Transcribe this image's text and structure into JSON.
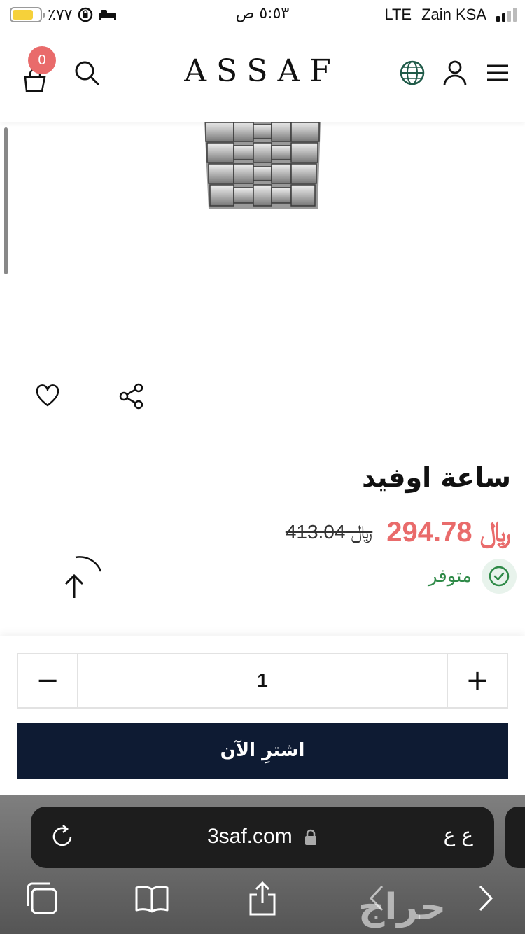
{
  "status_bar": {
    "battery_percent": "٪٧٧",
    "battery_level": 0.77,
    "time": "٥:٥٣ ص",
    "network": "LTE",
    "carrier": "Zain KSA"
  },
  "header": {
    "logo": "ASSAF",
    "cart_count": "0"
  },
  "product": {
    "title": "ساعة اوفيد",
    "price": "294.78",
    "old_price": "413.04",
    "currency_symbol": "﷼",
    "stock_status": "متوفر",
    "colors": {
      "price": "#e96b6b",
      "stock": "#2f8a48",
      "buy_button": "#0e1b33"
    }
  },
  "purchase": {
    "quantity": "1",
    "minus_label": "−",
    "plus_label": "+",
    "buy_label": "اشترِ الآن"
  },
  "browser": {
    "url": "3saf.com",
    "text_size_label": "ع ع",
    "watermark": "حراج"
  },
  "icons": [
    "cart-icon",
    "search-icon",
    "globe-icon",
    "user-icon",
    "menu-icon",
    "heart-icon",
    "share-icon",
    "back-to-top-icon",
    "check-circle-icon",
    "reload-icon",
    "lock-icon",
    "tabs-icon",
    "bookmarks-icon",
    "share-sheet-icon",
    "back-icon",
    "forward-icon"
  ]
}
